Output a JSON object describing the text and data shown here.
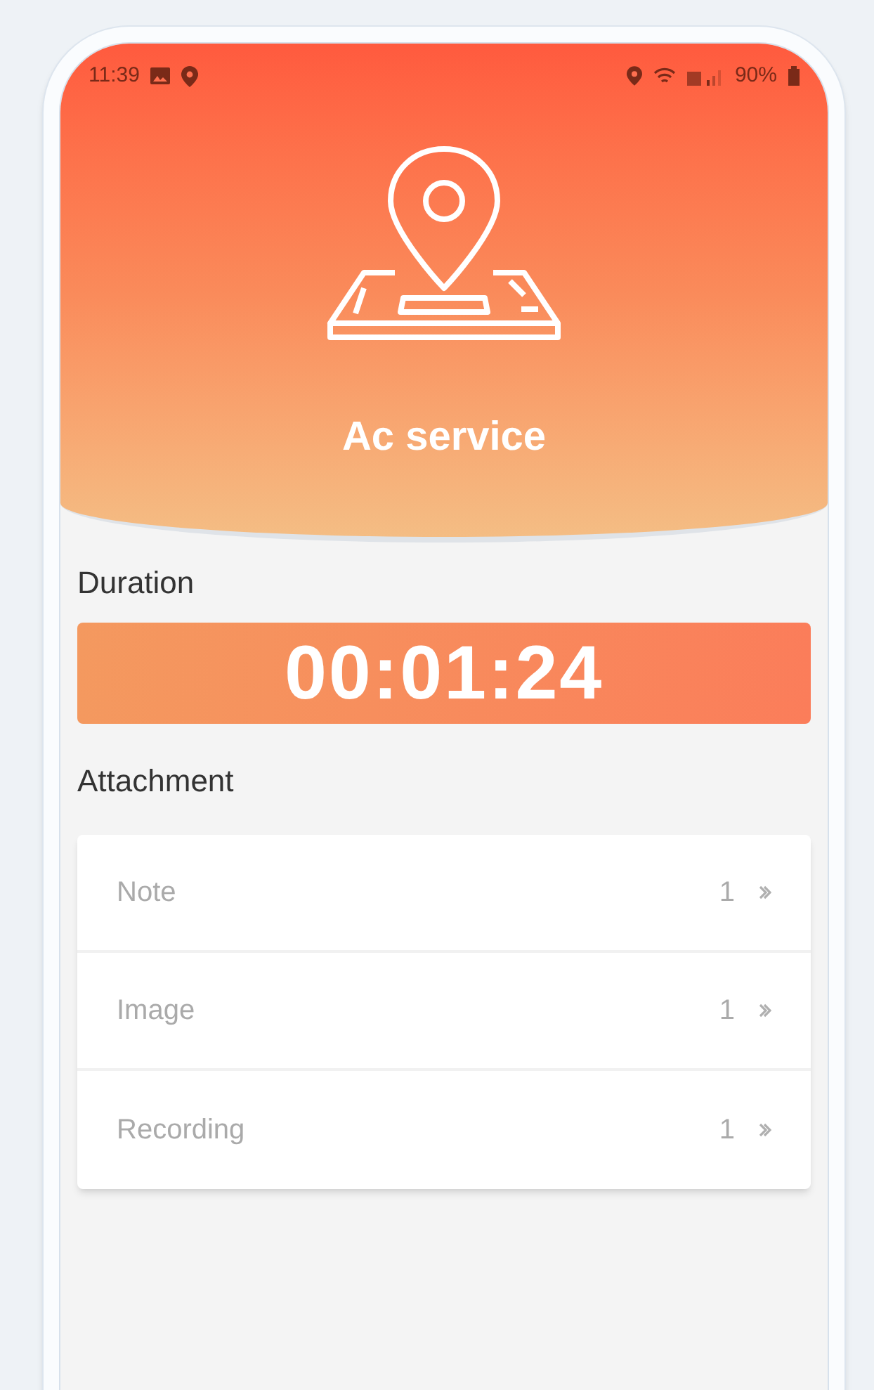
{
  "status_bar": {
    "time": "11:39",
    "battery": "90%"
  },
  "header": {
    "title": "Ac service"
  },
  "duration": {
    "label": "Duration",
    "timer": "00:01:24"
  },
  "attachment": {
    "label": "Attachment",
    "items": [
      {
        "name": "Note",
        "count": "1"
      },
      {
        "name": "Image",
        "count": "1"
      },
      {
        "name": "Recording",
        "count": "1"
      }
    ]
  }
}
